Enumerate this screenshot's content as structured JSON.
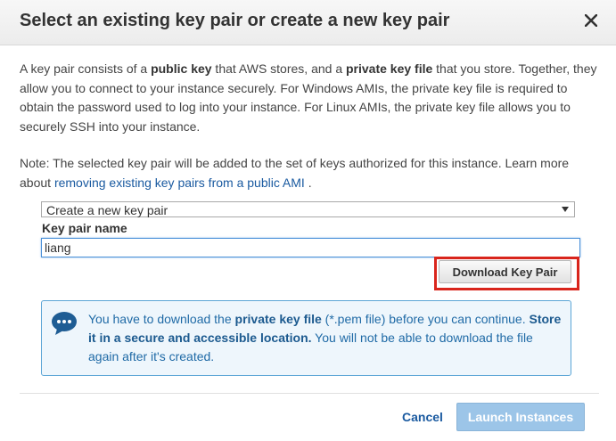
{
  "dialog": {
    "title": "Select an existing key pair or create a new key pair",
    "close_label": "✕"
  },
  "description": {
    "p1_a": "A key pair consists of a ",
    "p1_b": "public key",
    "p1_c": " that AWS stores, and a ",
    "p1_d": "private key file",
    "p1_e": " that you store. Together, they allow you to connect to your instance securely. For Windows AMIs, the private key file is required to obtain the password used to log into your instance. For Linux AMIs, the private key file allows you to securely SSH into your instance."
  },
  "note": {
    "text": "Note: The selected key pair will be added to the set of keys authorized for this instance. Learn more about ",
    "link": "removing existing key pairs from a public AMI",
    "end": " ."
  },
  "key_pair_select": {
    "value": "Create a new key pair"
  },
  "key_pair_name": {
    "label": "Key pair name",
    "value": "liang"
  },
  "download_button": {
    "label": "Download Key Pair"
  },
  "info_box": {
    "t1": "You have to download the ",
    "t2": "private key file",
    "t3": " (*.pem file) before you can continue. ",
    "t4": "Store it in a secure and accessible location.",
    "t5": " You will not be able to download the file again after it's created."
  },
  "footer": {
    "cancel_label": "Cancel",
    "launch_label": "Launch Instances"
  },
  "colors": {
    "link": "#1a5aa0",
    "highlight": "#d9251c",
    "info_bg": "#eef6fc",
    "launch_disabled": "#9cc5e8"
  },
  "icons": {
    "close": "close-icon",
    "info": "chat-bubble-icon",
    "dropdown": "chevron-down-icon"
  }
}
